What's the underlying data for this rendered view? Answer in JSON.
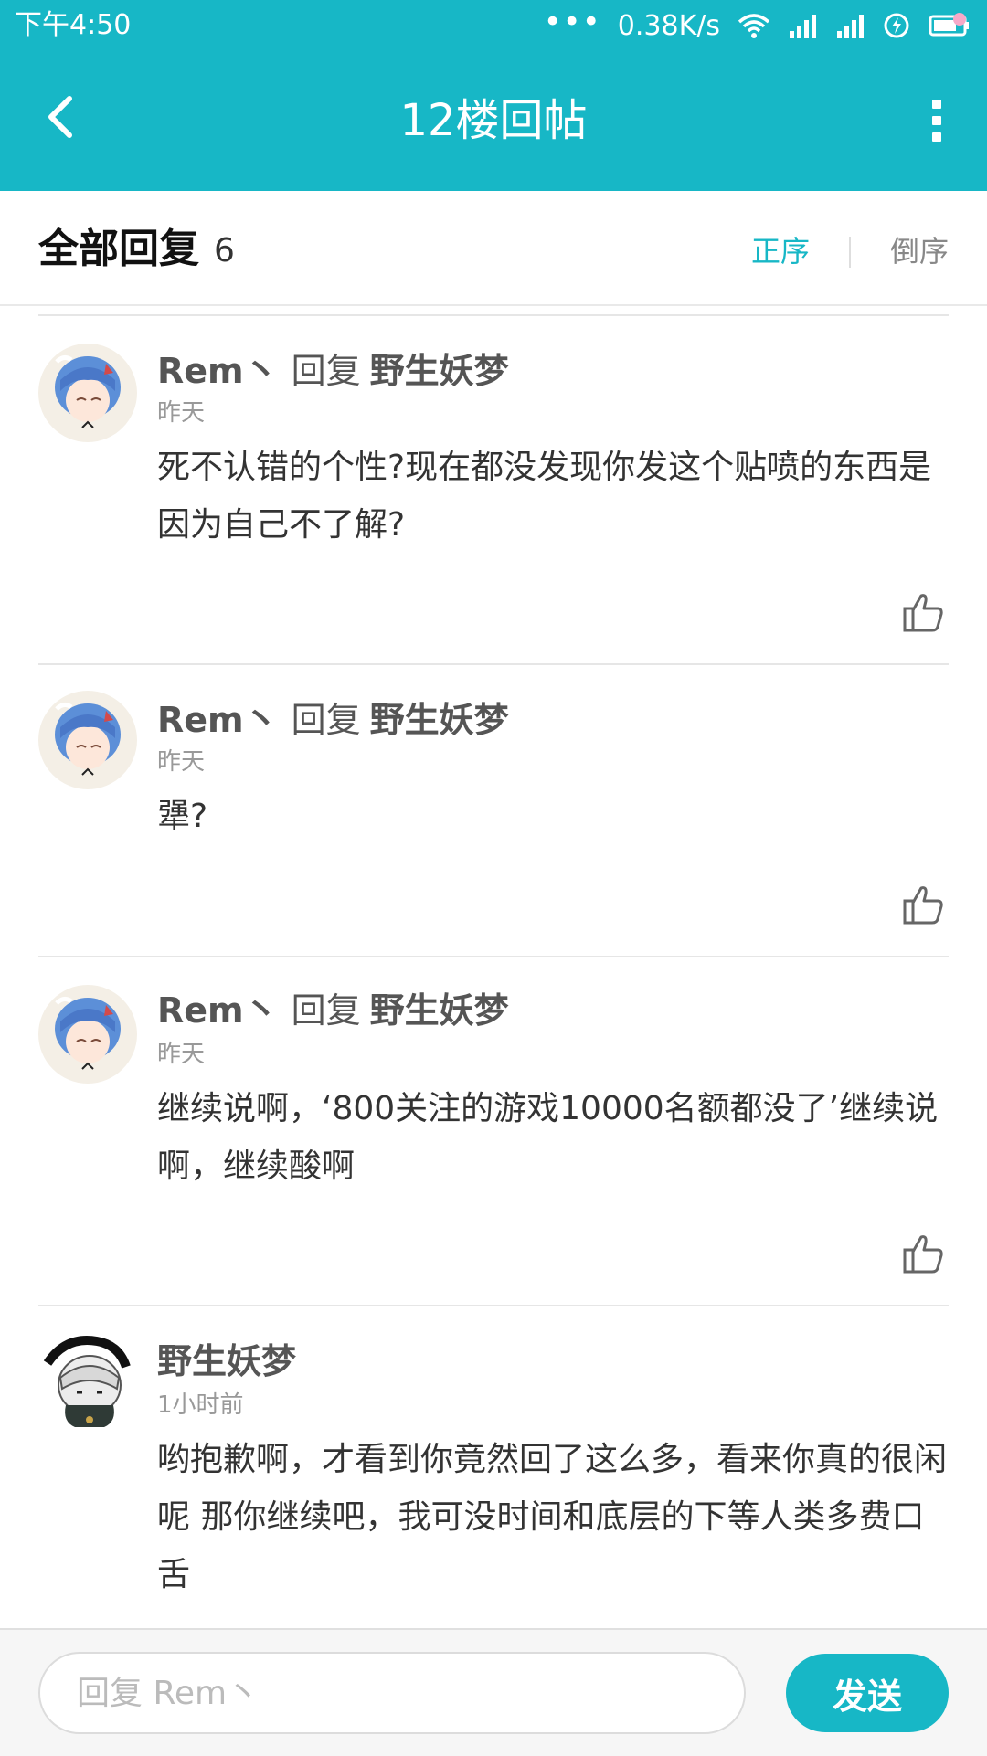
{
  "status_bar": {
    "time": "下午4:50",
    "dots": "•••",
    "net_speed": "0.38K/s"
  },
  "toolbar": {
    "title": "12楼回帖",
    "back_icon": "chevron-left-icon",
    "more_icon": "more-vertical-icon"
  },
  "header": {
    "title": "全部回复",
    "count": "6",
    "sort_asc": "正序",
    "sort_desc": "倒序",
    "accent_color": "#17b7c6"
  },
  "replies": [
    {
      "author": "Rem丶",
      "reply_word": "回复",
      "target": "野生妖梦",
      "time": "昨天",
      "text": "死不认错的个性?现在都没发现你发这个贴喷的东西是因为自己不了解?"
    },
    {
      "author": "Rem丶",
      "reply_word": "回复",
      "target": "野生妖梦",
      "time": "昨天",
      "text": "犟?"
    },
    {
      "author": "Rem丶",
      "reply_word": "回复",
      "target": "野生妖梦",
      "time": "昨天",
      "text": "继续说啊，‘800关注的游戏10000名额都没了’继续说啊，继续酸啊"
    },
    {
      "author": "野生妖梦",
      "reply_word": "",
      "target": "",
      "time": "1小时前",
      "text": "哟抱歉啊，才看到你竟然回了这么多，看来你真的很闲呢 那你继续吧，我可没时间和底层的下等人类多费口舌"
    }
  ],
  "composer": {
    "placeholder": "回复 Rem丶",
    "send_label": "发送"
  }
}
